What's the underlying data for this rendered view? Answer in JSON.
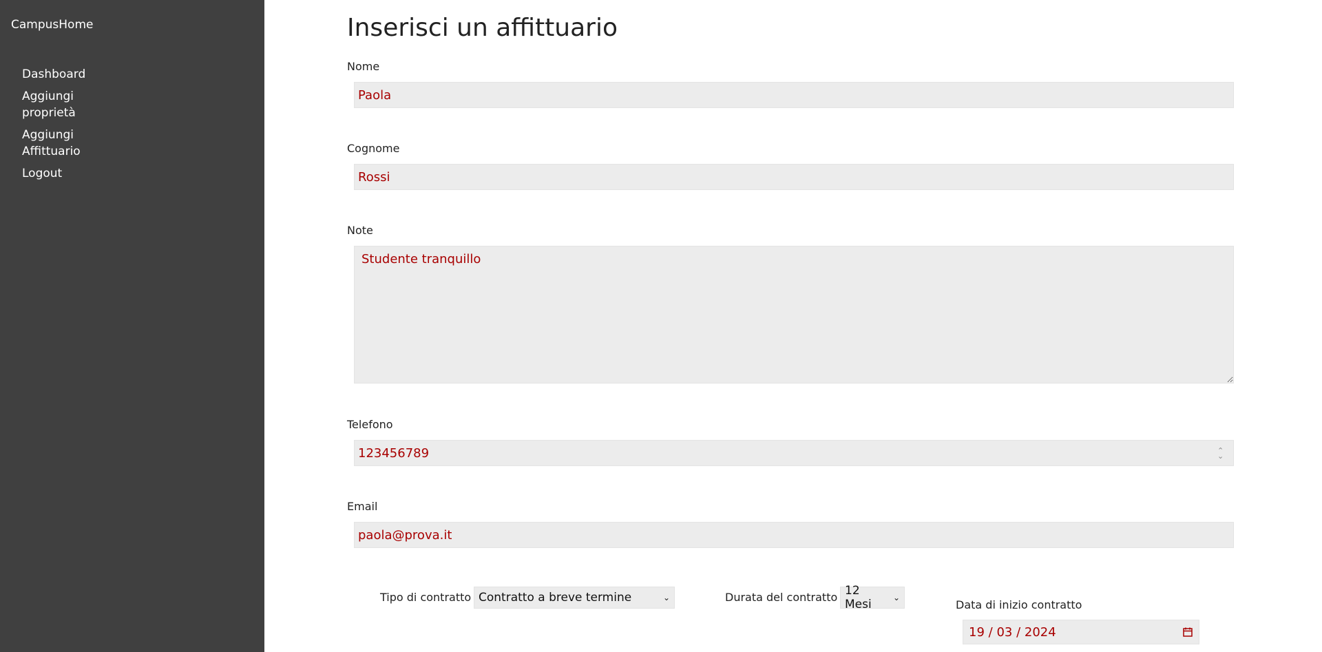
{
  "sidebar": {
    "brand": "CampusHome",
    "items": [
      {
        "label": "Dashboard"
      },
      {
        "label": "Aggiungi proprietà"
      },
      {
        "label": "Aggiungi Affittuario"
      },
      {
        "label": "Logout"
      }
    ]
  },
  "main": {
    "title": "Inserisci un affittuario",
    "fields": {
      "nome": {
        "label": "Nome",
        "value": "Paola"
      },
      "cognome": {
        "label": "Cognome",
        "value": "Rossi"
      },
      "note": {
        "label": "Note",
        "value": "Studente tranquillo"
      },
      "telefono": {
        "label": "Telefono",
        "value": "123456789"
      },
      "email": {
        "label": "Email",
        "value": "paola@prova.it"
      }
    },
    "contract": {
      "type_label": "Tipo di contratto",
      "type_value": "Contratto a breve termine",
      "duration_label": "Durata del contratto",
      "duration_value": "12 Mesi",
      "start_label": "Data di inizio contratto",
      "start_day": "19",
      "start_month": "03",
      "start_year": "2024"
    }
  },
  "colors": {
    "sidebar_bg": "#404040",
    "field_bg": "#ececec",
    "field_text": "#a80000"
  }
}
